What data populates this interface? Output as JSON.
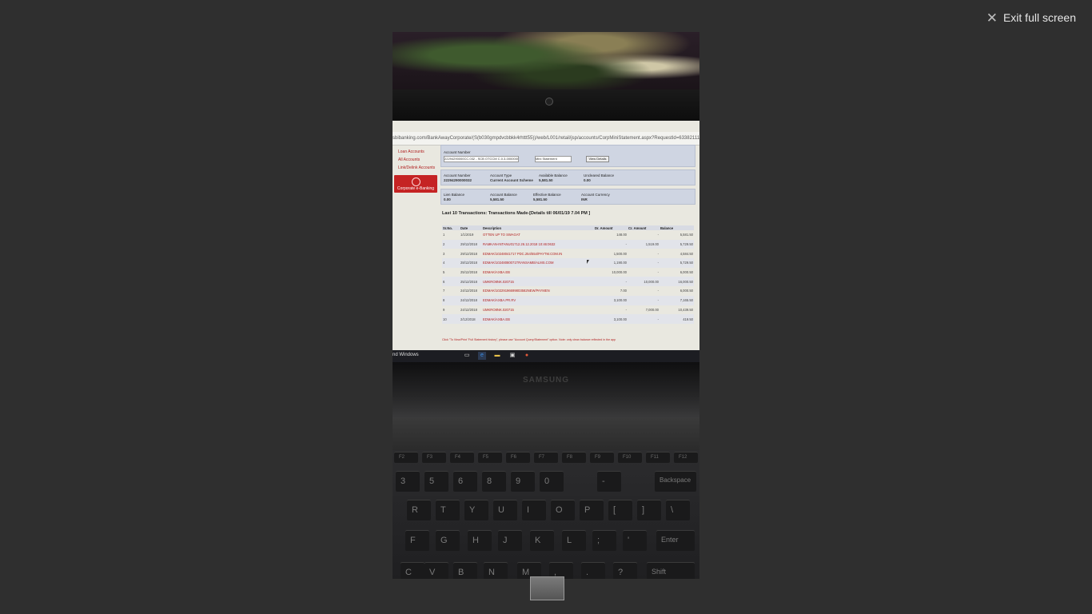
{
  "viewer": {
    "exit_label": "Exit full screen"
  },
  "browser": {
    "url": "sbibanking.com/BankAwayCorporate/(S(b030gmpdvcbbkk4rhttt55))/web/L001/retail/jsp/accounts/CorpMiniStatement.aspx?RequestId=63382111"
  },
  "bank": {
    "sidebar_links": [
      "Loan Accounts",
      "All Accounts",
      "Link/Delink Accounts"
    ],
    "logo_text": "Corporate e-Banking",
    "account_number_label": "Account Number",
    "account_select_value": "22294290000CC.032 - SCB OTCCM C.0.3-00000000092",
    "statement_select_value": "Mini Statement",
    "go_button": "View Details",
    "summary": {
      "account_number": {
        "label": "Account Number",
        "value": "22294290000032"
      },
      "account_type": {
        "label": "Account Type",
        "value": "Current Account Scheme"
      },
      "available_balance": {
        "label": "Available Balance",
        "value": "5,581.50"
      },
      "uncleared_balance": {
        "label": "Uncleared Balance",
        "value": "0.00"
      },
      "lien_balance": {
        "label": "Lien Balance",
        "value": "0.00"
      },
      "account_balance": {
        "label": "Account Balance",
        "value": "5,581.50"
      },
      "effective_balance": {
        "label": "Effective Balance",
        "value": "5,581.50"
      },
      "account_currency": {
        "label": "Account Currency",
        "value": "INR"
      }
    },
    "heading": "Last 10 Transactions: Transactions Made-[Details till 06/01/19 7.04 PM ]",
    "table": {
      "headers": [
        "Sr.No.",
        "Date",
        "Description",
        "Dr. Amount",
        "Cr. Amount",
        "Balance"
      ],
      "rows": [
        [
          "1",
          "1/1/2019",
          "OTTEN UP TO SWAGAT",
          "148.00",
          "-",
          "5,581.50"
        ],
        [
          "2",
          "29/12/2018",
          "RAMKAN-INTANU01712.26.12.2018 10:46:0632",
          "-",
          "1,519.00",
          "5,729.50"
        ],
        [
          "3",
          "29/12/2018",
          "EDMAK/10248041717 PDC.254/554/PAYTM.COM.IN",
          "1,500.00",
          "-",
          "4,584.50"
        ],
        [
          "4",
          "28/12/2018",
          "EDMAK/10248080071TRANSAMB/ALMS.COM",
          "1,190.00",
          "-",
          "5,729.50"
        ],
        [
          "5",
          "25/12/2018",
          "EDMAK/AXBA.EB",
          "10,000.00",
          "-",
          "6,000.50"
        ],
        [
          "6",
          "25/12/2018",
          "UMKRO8NK.020715",
          "-",
          "10,000.00",
          "16,000.50"
        ],
        [
          "7",
          "24/12/2018",
          "EDMAK/10229196699803582NEW/PAYMEN",
          "7.00",
          "-",
          "6,000.50"
        ],
        [
          "8",
          "24/12/2018",
          "EDMAK/AXBA.PR.RV",
          "3,100.00",
          "-",
          "7,165.50"
        ],
        [
          "9",
          "24/12/2018",
          "UMKRO8NK.020715",
          "-",
          "7,000.00",
          "10,439.50"
        ],
        [
          "10",
          "2/12/2018",
          "EDMAK/AXBA.EB",
          "3,100.00",
          "-",
          "419.50"
        ]
      ]
    },
    "note": "Click \"To View/Print \"Full Statement history\", please use \"Account Query/Statement\" option. Note: only clean balance reflected in the app"
  },
  "taskbar": {
    "text": "nd Windows"
  },
  "laptop": {
    "brand": "SAMSUNG"
  },
  "keyboard": {
    "fn_row": [
      "F2",
      "F3",
      "F4",
      "F5",
      "F6",
      "F7",
      "F8",
      "F9",
      "F10",
      "F11",
      "F12"
    ],
    "num_row": [
      "3",
      "5",
      "6",
      "8",
      "9",
      "0",
      "-",
      "Backspace"
    ],
    "top_row": [
      "R",
      "T",
      "Y",
      "U",
      "I",
      "O",
      "P",
      "[",
      "]",
      "\\"
    ],
    "home_row": [
      "F",
      "G",
      "H",
      "J",
      "K",
      "L",
      ";",
      "'",
      "Enter"
    ],
    "bottom_row": [
      "C",
      "V",
      "B",
      "N",
      "M",
      ",",
      ".",
      "?",
      "Shift"
    ]
  }
}
